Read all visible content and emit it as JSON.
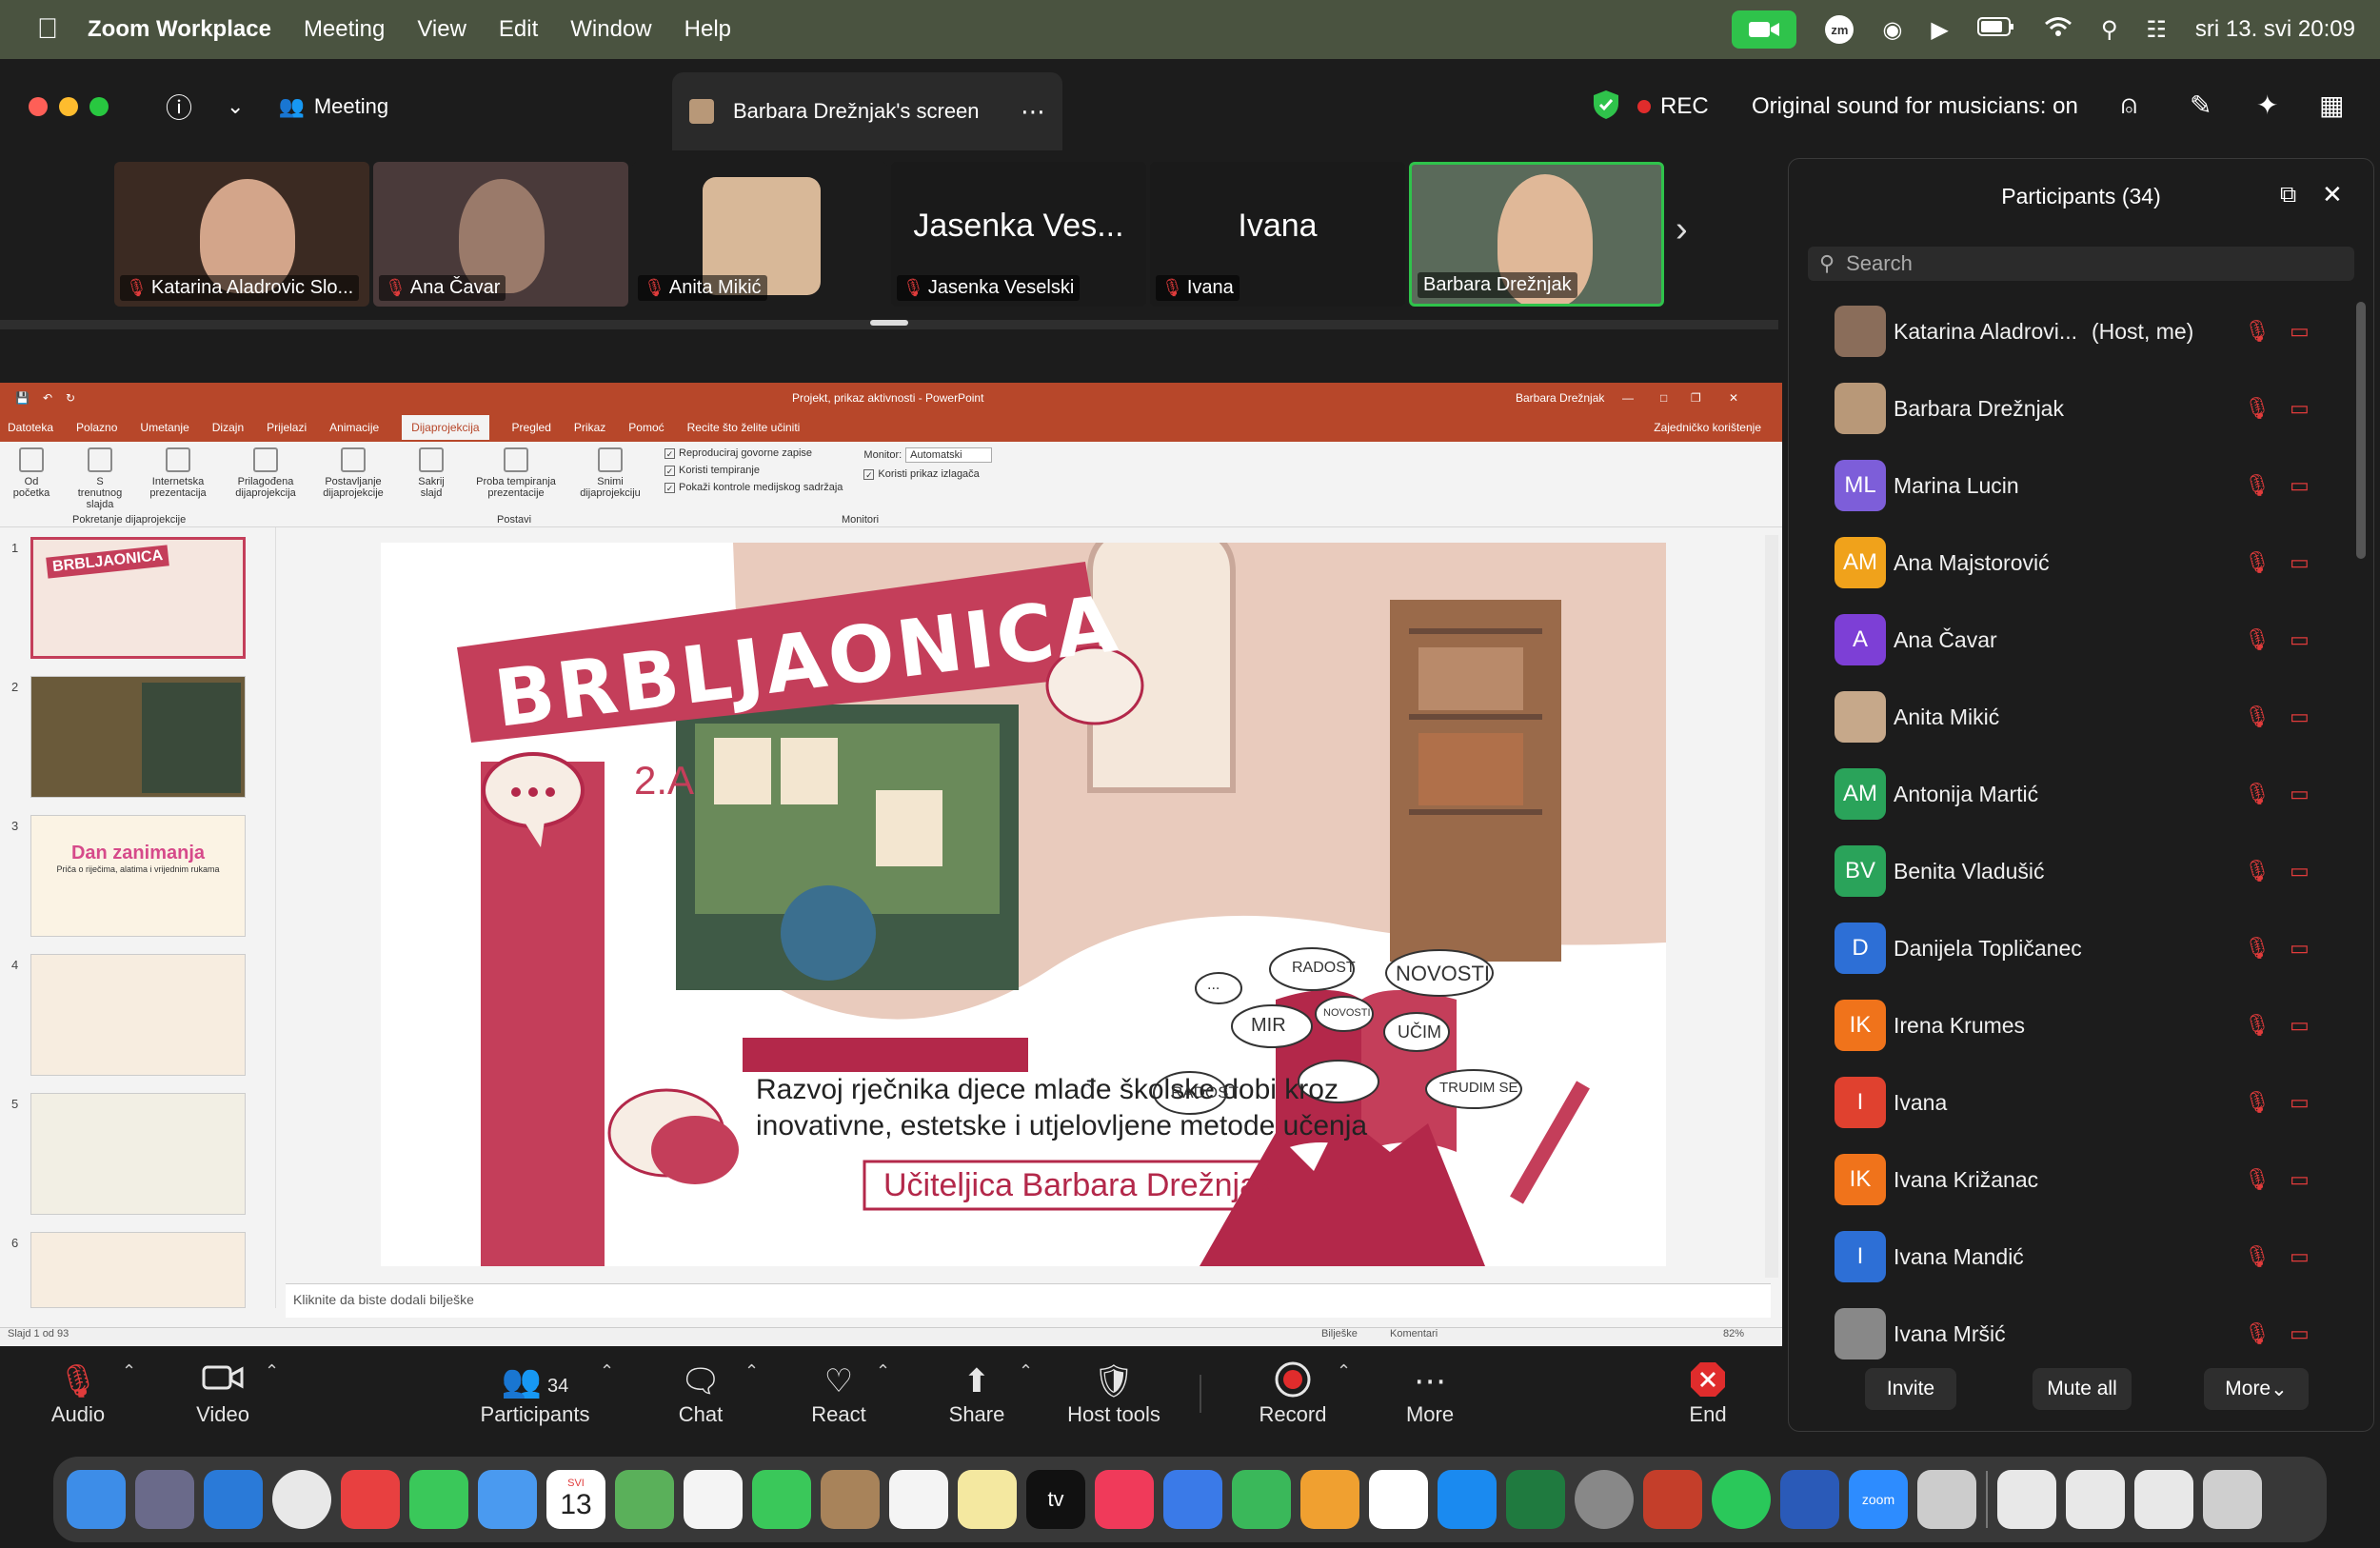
{
  "menubar": {
    "app_name": "Zoom Workplace",
    "items": [
      "Meeting",
      "View",
      "Edit",
      "Window",
      "Help"
    ],
    "clock": "sri 13. svi  20:09",
    "zm_label": "zm"
  },
  "titlebar": {
    "meeting_label": "Meeting",
    "screen_tab": "Barbara Drežnjak's screen",
    "rec_label": "REC",
    "original_sound": "Original sound for musicians: on"
  },
  "video_tiles": [
    {
      "name": "Katarina Aladrovic Slo..."
    },
    {
      "name": "Ana Čavar"
    },
    {
      "name": "Anita Mikić"
    },
    {
      "name": "Jasenka Veselski",
      "big": "Jasenka Ves..."
    },
    {
      "name": "Ivana",
      "big": "Ivana"
    },
    {
      "name": "Barbara Drežnjak"
    }
  ],
  "ppt": {
    "window_title": "Projekt, prikaz aktivnosti  -  PowerPoint",
    "user": "Barbara Drežnjak",
    "tabs": [
      "Datoteka",
      "Polazno",
      "Umetanje",
      "Dizajn",
      "Prijelazi",
      "Animacije",
      "Dijaprojekcija",
      "Pregled",
      "Prikaz",
      "Pomoć",
      "Recite što želite učiniti"
    ],
    "share_label": "Zajedničko korištenje",
    "ribbon_buttons": [
      "Od početka",
      "S trenutnog slajda",
      "Internetska prezentacija",
      "Prilagođena dijaprojekcija",
      "Postavljanje dijaprojekcije",
      "Sakrij slajd",
      "Proba tempiranja prezentacije",
      "Snimi dijaprojekciju"
    ],
    "checkboxes": [
      "Reproduciraj govorne zapise",
      "Koristi tempiranje",
      "Pokaži kontrole medijskog sadržaja"
    ],
    "monitor_label": "Monitor:",
    "monitor_value": "Automatski",
    "presenter_view": "Koristi prikaz izlagača",
    "group_labels": [
      "Pokretanje dijaprojekcije",
      "Postavi",
      "Monitori"
    ],
    "thumb_numbers": [
      "1",
      "2",
      "3",
      "4",
      "5",
      "6"
    ],
    "thumb_texts": [
      "BRBLJAONICA",
      "Dan zanimanja",
      "Priča o riječima, alatima i vrijednim rukama"
    ],
    "notes_placeholder": "Kliknite da biste dodali bilješke",
    "status": "Slajd 1 od 93",
    "status_right": [
      "Bilješke",
      "Komentari",
      "82%"
    ]
  },
  "slide": {
    "title": "BRBLJAONICA",
    "class": "2.A",
    "subtitle_line1": "Razvoj rječnika djece mlađe školske dobi kroz",
    "subtitle_line2": "inovativne, estetske i utjelovljene metode učenja",
    "author": "Učiteljica Barbara Drežnjak",
    "bubbles": [
      "RADOST",
      "NOVOSTI",
      "MIR",
      "NOVOSTI",
      "UČIM",
      "RADOST",
      "TRUDIM SE",
      "..."
    ]
  },
  "toolbar": {
    "audio": "Audio",
    "video": "Video",
    "participants": "Participants",
    "participants_count": "34",
    "chat": "Chat",
    "react": "React",
    "share": "Share",
    "host_tools": "Host tools",
    "record": "Record",
    "more": "More",
    "end": "End"
  },
  "panel": {
    "title": "Participants (34)",
    "search_placeholder": "Search",
    "participants": [
      {
        "name": "Katarina Aladrovi...",
        "tag": "(Host, me)",
        "initials": "",
        "color": "#8a6d5a"
      },
      {
        "name": "Barbara Drežnjak",
        "tag": "",
        "initials": "",
        "color": "#b89878"
      },
      {
        "name": "Marina Lucin",
        "tag": "",
        "initials": "ML",
        "color": "#7d5ed9"
      },
      {
        "name": "Ana Majstorović",
        "tag": "",
        "initials": "AM",
        "color": "#f0a21b"
      },
      {
        "name": "Ana Čavar",
        "tag": "",
        "initials": "A",
        "color": "#7d3fd6"
      },
      {
        "name": "Anita Mikić",
        "tag": "",
        "initials": "",
        "color": "#c6a88a"
      },
      {
        "name": "Antonija Martić",
        "tag": "",
        "initials": "AM",
        "color": "#2aa35a"
      },
      {
        "name": "Benita Vladušić",
        "tag": "",
        "initials": "BV",
        "color": "#2aa35a"
      },
      {
        "name": "Danijela Topličanec",
        "tag": "",
        "initials": "D",
        "color": "#2d6fd6"
      },
      {
        "name": "Irena Krumes",
        "tag": "",
        "initials": "IK",
        "color": "#f0731b"
      },
      {
        "name": "Ivana",
        "tag": "",
        "initials": "I",
        "color": "#e0412f"
      },
      {
        "name": "Ivana Križanac",
        "tag": "",
        "initials": "IK",
        "color": "#f0731b"
      },
      {
        "name": "Ivana Mandić",
        "tag": "",
        "initials": "I",
        "color": "#2d6fd6"
      },
      {
        "name": "Ivana Mršić",
        "tag": "",
        "initials": "",
        "color": "#888"
      }
    ],
    "invite": "Invite",
    "mute_all": "Mute all",
    "more": "More"
  },
  "dock": {
    "calendar_month": "SVI",
    "calendar_day": "13",
    "tv_label": "tv",
    "zoom_label": "zoom"
  }
}
